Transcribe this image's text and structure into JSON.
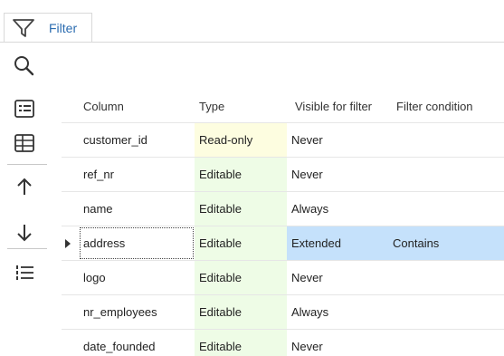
{
  "tab": {
    "label": "Filter",
    "icon": "filter-funnel-icon"
  },
  "toolbar": {
    "buttons": [
      {
        "name": "search-icon"
      },
      {
        "name": "properties-list-icon"
      },
      {
        "name": "table-grid-icon"
      },
      {
        "name": "arrow-up-icon"
      },
      {
        "name": "arrow-down-icon"
      },
      {
        "name": "numbered-list-icon"
      }
    ]
  },
  "grid": {
    "headers": {
      "column": "Column",
      "type": "Type",
      "visible": "Visible for filter",
      "condition": "Filter condition"
    },
    "rows": [
      {
        "column": "customer_id",
        "type": "Read-only",
        "visible": "Never",
        "condition": ""
      },
      {
        "column": "ref_nr",
        "type": "Editable",
        "visible": "Never",
        "condition": ""
      },
      {
        "column": "name",
        "type": "Editable",
        "visible": "Always",
        "condition": ""
      },
      {
        "column": "address",
        "type": "Editable",
        "visible": "Extended",
        "condition": "Contains"
      },
      {
        "column": "logo",
        "type": "Editable",
        "visible": "Never",
        "condition": ""
      },
      {
        "column": "nr_employees",
        "type": "Editable",
        "visible": "Always",
        "condition": ""
      },
      {
        "column": "date_founded",
        "type": "Editable",
        "visible": "Never",
        "condition": ""
      }
    ],
    "selected_row": 3
  },
  "colors": {
    "accent": "#2b6cb0",
    "readonly_bg": "#fdfde0",
    "editable_bg": "#eefce6",
    "selected_bg": "#c5e1fb"
  }
}
